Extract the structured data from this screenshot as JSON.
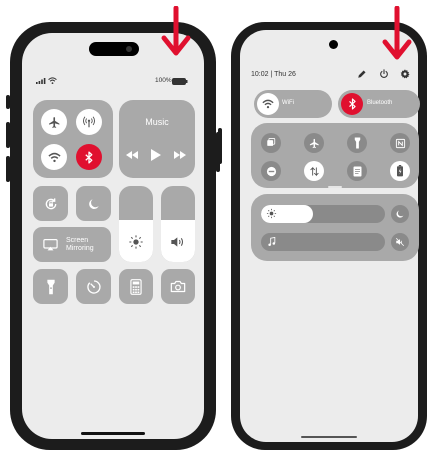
{
  "colors": {
    "accent": "#e0102f",
    "tile": "#a9a9a9",
    "frame": "#1c1c1c",
    "screen": "#ececec"
  },
  "left_phone": {
    "status": {
      "battery": "100%"
    },
    "music": {
      "title": "Music"
    },
    "screen_mirroring": {
      "label_line1": "Screen",
      "label_line2": "Mirroring"
    }
  },
  "right_phone": {
    "status": {
      "time": "10:02 | Thu 26"
    },
    "wifi": {
      "label": "WiFi"
    },
    "bluetooth": {
      "label": "Bluetooth"
    }
  }
}
